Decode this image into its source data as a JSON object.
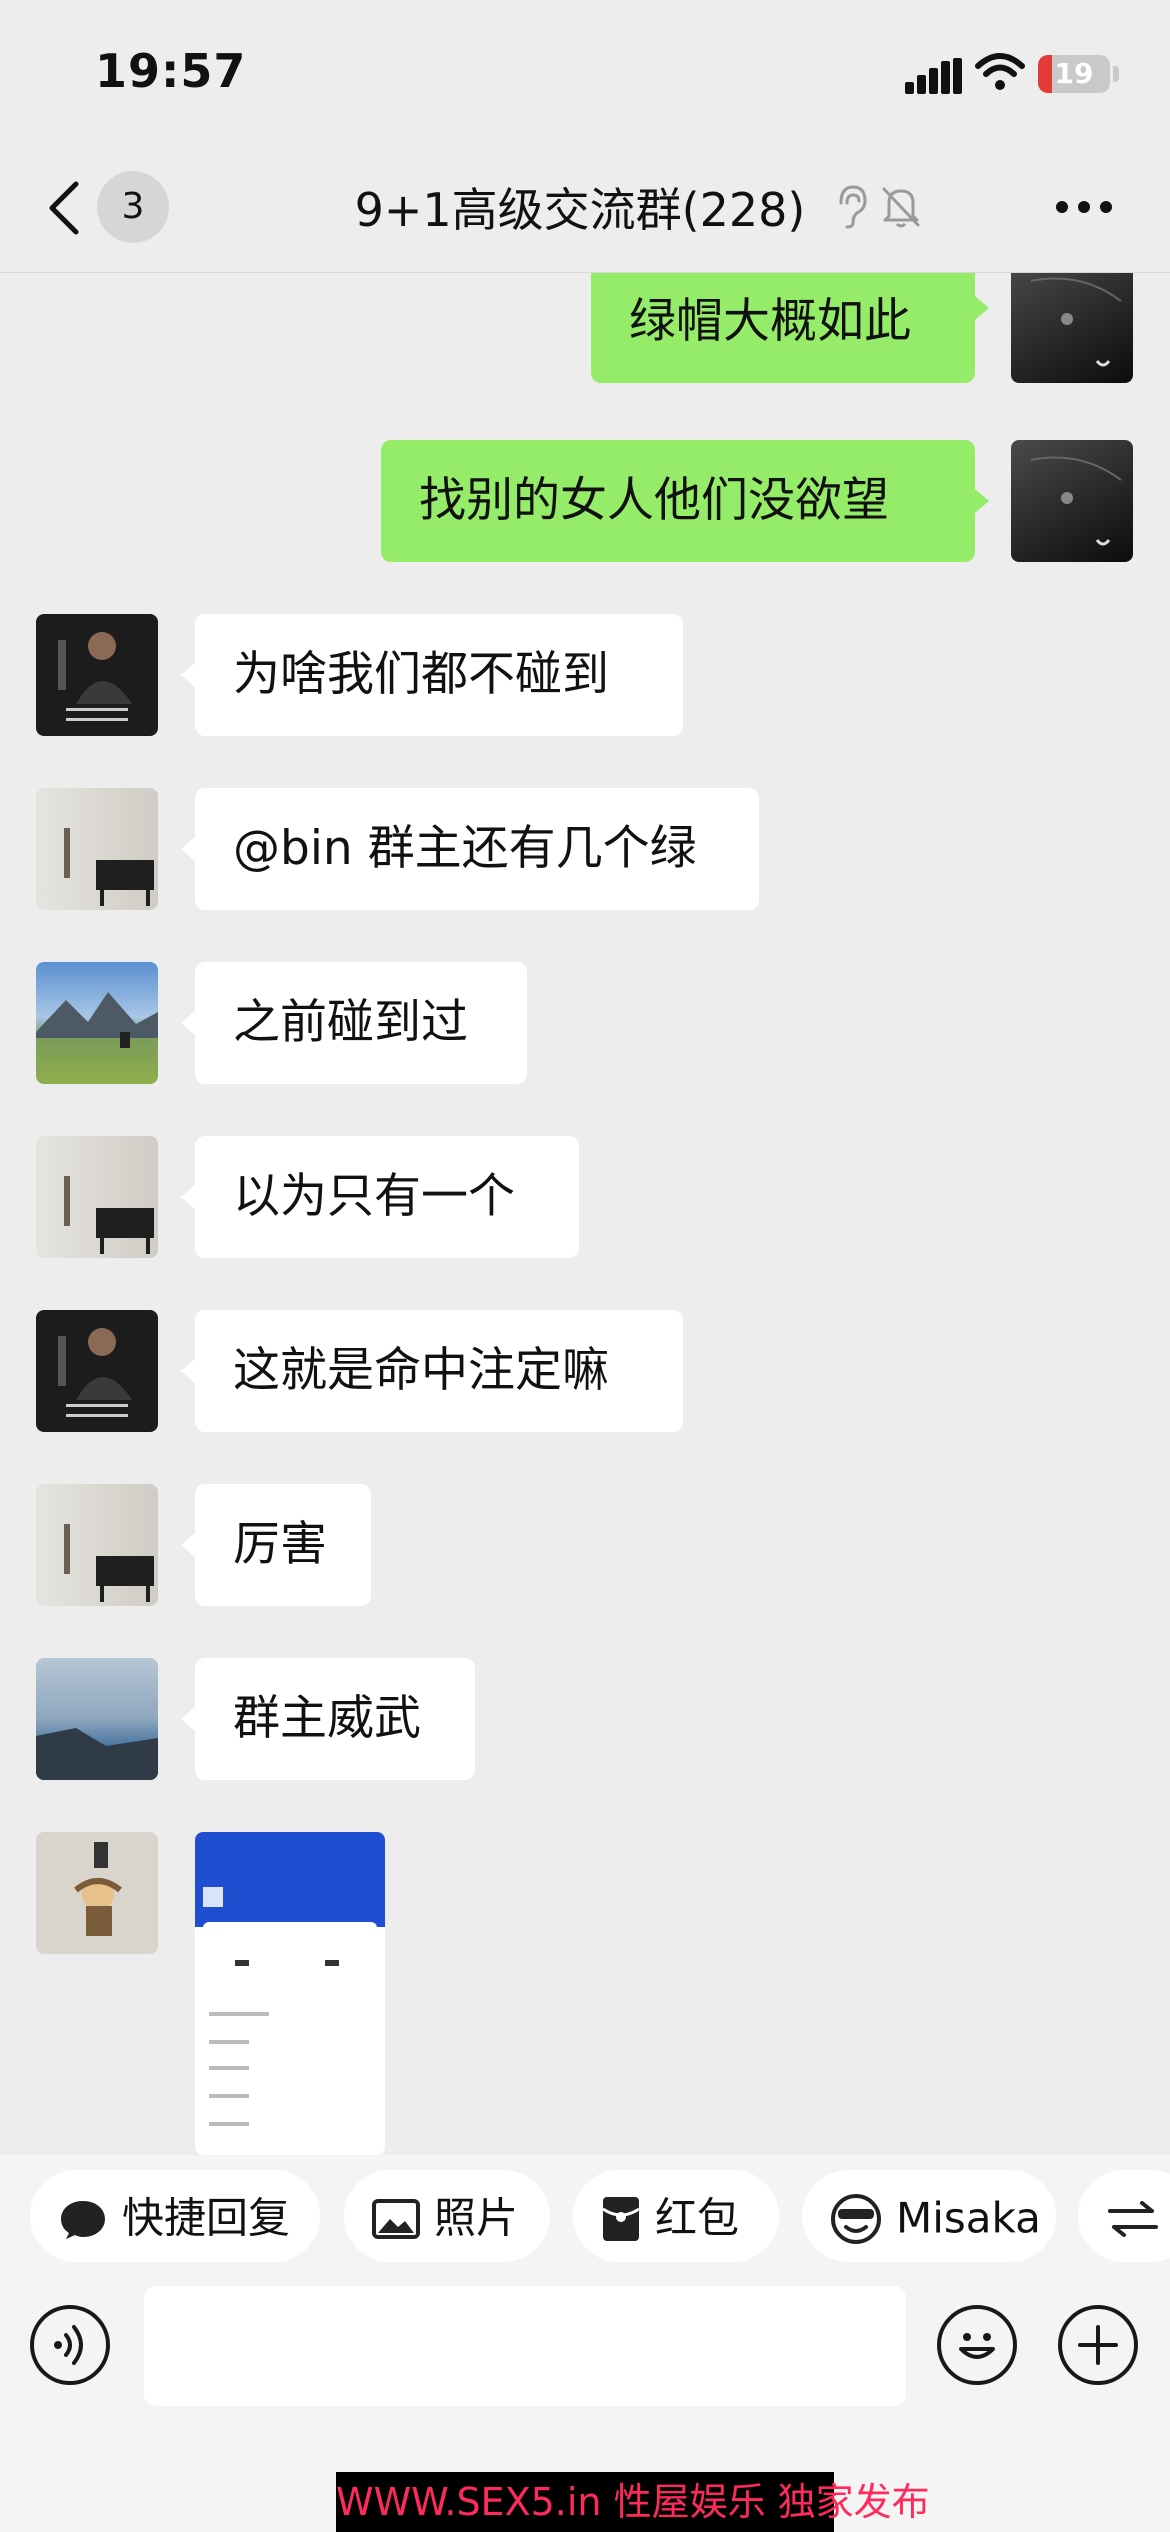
{
  "status_bar": {
    "time": "19:57",
    "battery_level": "19",
    "battery_fraction": 0.19,
    "colors": {
      "battery_low": "#e53b37"
    }
  },
  "nav": {
    "back_badge_count": "3",
    "title": "9+1高级交流群(228)",
    "icons": [
      "back-chevron-icon",
      "earpiece-icon",
      "muted-bell-icon",
      "more-icon"
    ]
  },
  "messages": [
    {
      "side": "me",
      "text": "绿帽大概如此",
      "avatar": "black-umbrella"
    },
    {
      "side": "me",
      "text": "找别的女人他们没欲望",
      "avatar": "black-umbrella"
    },
    {
      "side": "other",
      "text": "为啥我们都不碰到",
      "avatar": "man-in-suit"
    },
    {
      "side": "other",
      "text": "@bin 群主还有几个绿",
      "avatar": "chair-by-window"
    },
    {
      "side": "other",
      "text": "之前碰到过",
      "avatar": "mountain-rider"
    },
    {
      "side": "other",
      "text": "以为只有一个",
      "avatar": "chair-by-window"
    },
    {
      "side": "other",
      "text": "这就是命中注定嘛",
      "avatar": "man-in-suit"
    },
    {
      "side": "other",
      "text": "厉害",
      "avatar": "chair-by-window"
    },
    {
      "side": "other",
      "text": "群主威武",
      "avatar": "sea-cliff"
    },
    {
      "side": "other",
      "image": "app-screenshot-thumbnail",
      "avatar": "cartoon-character"
    }
  ],
  "quick_actions": [
    {
      "label": "快捷回复",
      "icon": "chat-bubble-icon"
    },
    {
      "label": "照片",
      "icon": "photo-icon"
    },
    {
      "label": "红包",
      "icon": "red-packet-icon"
    },
    {
      "label": "Misaka",
      "icon": "sunglasses-face-icon"
    },
    {
      "label": "",
      "icon": "switch-arrows-icon"
    }
  ],
  "input": {
    "value": "",
    "placeholder": ""
  },
  "watermark": {
    "site": "WWW.SEX5.in",
    "slogan": "性屋娱乐 独家发布"
  },
  "colors": {
    "background": "#ededed",
    "my_bubble": "#95ec69",
    "other_bubble": "#ffffff",
    "watermark_text": "#ff2a5c"
  }
}
